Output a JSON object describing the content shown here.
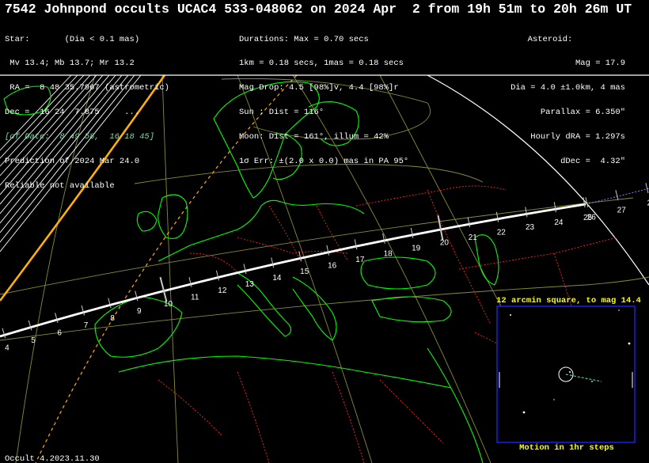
{
  "title": "7542 Johnpond occults UCAC4 533-048062 on 2024 Apr  2 from 19h 51m to 20h 26m UT",
  "star": {
    "heading": "Star:       (Dia < 0.1 mas)",
    "mags": " Mv 13.4; Mb 13.7; Mr 13.2",
    "ra": " RA =  8 48 35.7967 (astrometric)",
    "dec": "Dec =  16 24  7.875     ...",
    "of_date": "[of Date:  8 49 58,  16 18 45]",
    "prediction": "Prediction of 2024 Mar 24.0",
    "reliability": "Reliable not available"
  },
  "event": {
    "durations": "Durations: Max = 0.70 secs",
    "km_mas": "1km = 0.18 secs, 1mas = 0.18 secs",
    "mag_drop": "Mag Drop: 4.5 [98%]v, 4.4 [98%]r",
    "sun": "Sun : Dist = 116°",
    "moon": "Moon: Dist = 161°, illum = 42%",
    "error": "1σ Err: ±(2.0 x 0.0) mas in PA 95°"
  },
  "asteroid": {
    "heading": "Asteroid:",
    "mag": "Mag = 17.9",
    "dia": "Dia = 4.0 ±1.0km, 4 mas",
    "parallax": "Parallax = 6.350\"",
    "hourly_dra": "Hourly dRA = 1.297s",
    "ddec": "dDec =  4.32\""
  },
  "path_labels": [
    "4",
    "5",
    "6",
    "7",
    "8",
    "9",
    "10",
    "11",
    "12",
    "13",
    "14",
    "15",
    "16",
    "17",
    "18",
    "19",
    "20",
    "21",
    "22",
    "23",
    "24",
    "25",
    "26",
    "27",
    "2"
  ],
  "inset": {
    "title": "12 arcmin square, to mag 14.4",
    "footer": "Motion in 1hr steps"
  },
  "version": "Occult 4.2023.11.30",
  "colors": {
    "background": "#000000",
    "coastline": "#00ff00",
    "borders": "#ff2020",
    "graticule": "#8a8a3a",
    "path": "#ffffff",
    "error_limit": "#ffa500",
    "sigma_limit": "#ffb000",
    "inset_frame": "#2020ff",
    "inset_text": "#ffff00",
    "motion": "#40d0a0"
  }
}
